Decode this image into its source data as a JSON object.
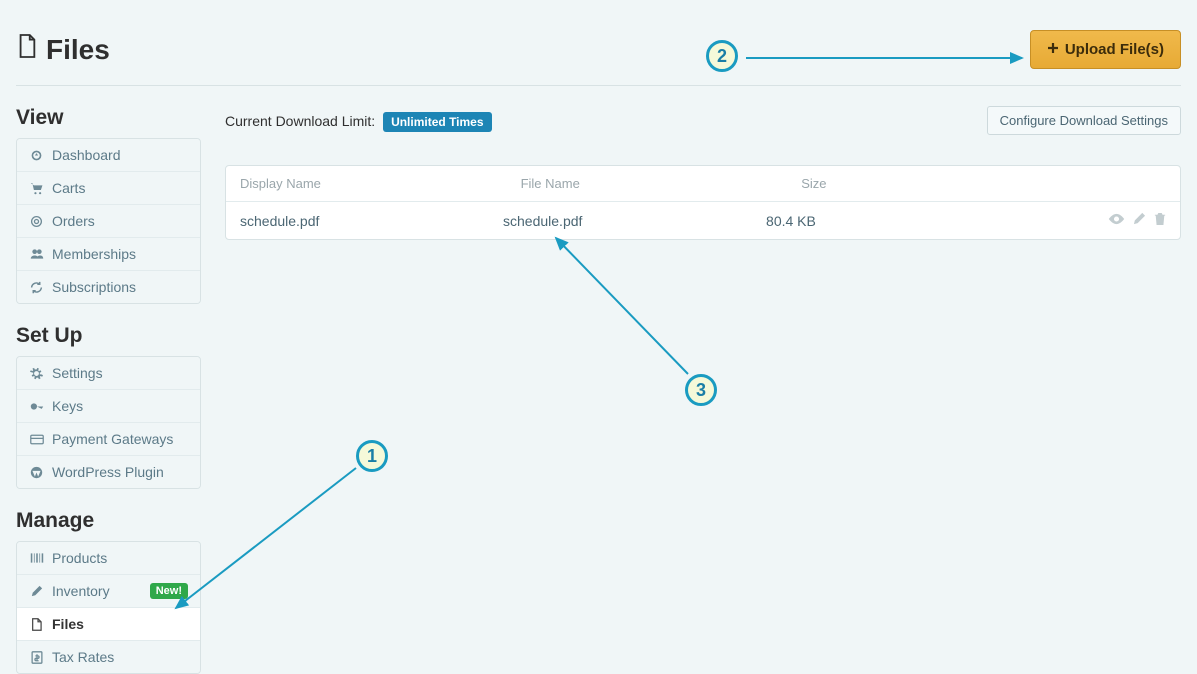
{
  "page": {
    "title": "Files",
    "upload_button": "Upload File(s)"
  },
  "download_limit": {
    "label": "Current Download Limit:",
    "value": "Unlimited Times",
    "configure_button": "Configure Download Settings"
  },
  "table": {
    "headers": {
      "display_name": "Display Name",
      "file_name": "File Name",
      "size": "Size"
    },
    "rows": [
      {
        "display_name": "schedule.pdf",
        "file_name": "schedule.pdf",
        "size": "80.4 KB"
      }
    ]
  },
  "sidebar": {
    "sections": {
      "view": {
        "title": "View",
        "items": [
          {
            "icon": "dashboard",
            "label": "Dashboard"
          },
          {
            "icon": "cart",
            "label": "Carts"
          },
          {
            "icon": "orders",
            "label": "Orders"
          },
          {
            "icon": "members",
            "label": "Memberships"
          },
          {
            "icon": "refresh",
            "label": "Subscriptions"
          }
        ]
      },
      "setup": {
        "title": "Set Up",
        "items": [
          {
            "icon": "gear",
            "label": "Settings"
          },
          {
            "icon": "key",
            "label": "Keys"
          },
          {
            "icon": "card",
            "label": "Payment Gateways"
          },
          {
            "icon": "wordpress",
            "label": "WordPress Plugin"
          }
        ]
      },
      "manage": {
        "title": "Manage",
        "items": [
          {
            "icon": "barcode",
            "label": "Products"
          },
          {
            "icon": "pencil",
            "label": "Inventory",
            "badge": "New!"
          },
          {
            "icon": "file",
            "label": "Files",
            "active": true
          },
          {
            "icon": "dollar",
            "label": "Tax Rates"
          }
        ]
      }
    }
  },
  "annotations": {
    "b1": "1",
    "b2": "2",
    "b3": "3"
  }
}
